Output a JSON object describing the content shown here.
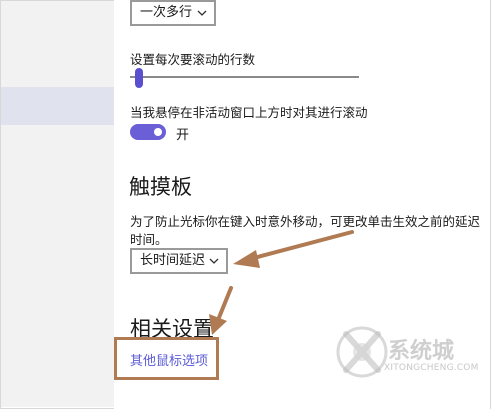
{
  "top_dropdown": {
    "value": "一次多行"
  },
  "scroll_lines": {
    "label": "设置每次要滚动的行数",
    "value_fraction": 0.03
  },
  "inactive_scroll": {
    "label": "当我悬停在非活动窗口上方时对其进行滚动",
    "state_label": "开",
    "on": true
  },
  "touchpad": {
    "heading": "触摸板",
    "desc_line1": "为了防止光标你在键入时意外移动，可更改单击生效之前的延迟",
    "desc_line2": "时间。",
    "delay_value": "长时间延迟"
  },
  "related": {
    "heading": "相关设置",
    "link": "其他鼠标选项"
  },
  "watermark": {
    "brand_line1": "系统城",
    "brand_line2": "XITONGCHENG.COM"
  },
  "colors": {
    "accent": "#6b5fd8",
    "link": "#5b5bd6",
    "annotation": "#b07a52"
  },
  "icons": {
    "dropdown": "chevron-down-icon",
    "arrow": "annotation-arrow"
  }
}
